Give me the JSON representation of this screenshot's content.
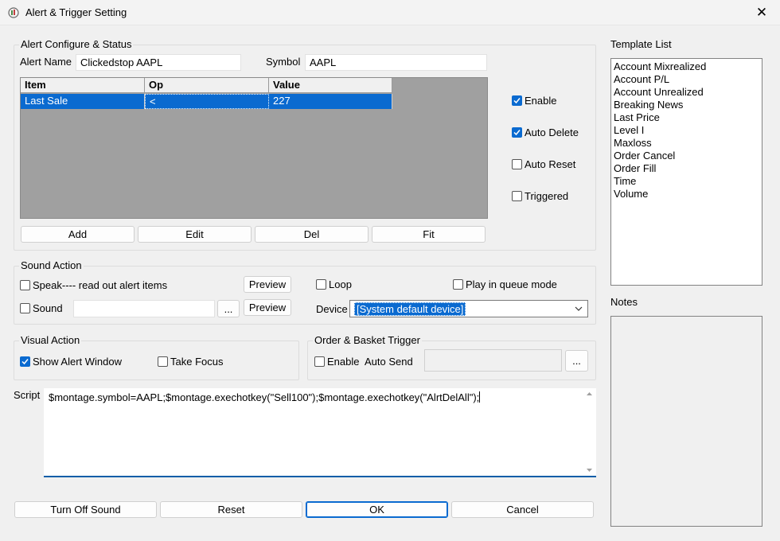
{
  "window": {
    "title": "Alert & Trigger Setting",
    "close_symbol": "✕"
  },
  "alert_configure": {
    "group_title": "Alert Configure & Status",
    "alert_name_label": "Alert Name",
    "alert_name_value": "Clickedstop AAPL",
    "symbol_label": "Symbol",
    "symbol_value": "AAPL",
    "grid": {
      "columns": [
        "Item",
        "Op",
        "Value"
      ],
      "rows": [
        {
          "item": "Last Sale",
          "op": "<",
          "value": "227"
        }
      ]
    },
    "buttons": {
      "add": "Add",
      "edit": "Edit",
      "del": "Del",
      "fit": "Fit"
    },
    "checkboxes": {
      "enable": {
        "label": "Enable",
        "checked": true
      },
      "auto_delete": {
        "label": "Auto Delete",
        "checked": true
      },
      "auto_reset": {
        "label": "Auto Reset",
        "checked": false
      },
      "triggered": {
        "label": "Triggered",
        "checked": false
      }
    }
  },
  "template_list": {
    "title": "Template List",
    "items": [
      "Account Mixrealized",
      "Account P/L",
      "Account Unrealized",
      "Breaking News",
      "Last Price",
      "Level I",
      "Maxloss",
      "Order Cancel",
      "Order Fill",
      "Time",
      "Volume"
    ]
  },
  "notes": {
    "title": "Notes"
  },
  "sound_action": {
    "group_title": "Sound Action",
    "speak_label": "Speak---- read out alert items",
    "speak_checked": false,
    "sound_label": "Sound",
    "sound_checked": false,
    "sound_file_value": "",
    "browse_label": "...",
    "preview_label": "Preview",
    "loop_label": "Loop",
    "loop_checked": false,
    "queue_label": "Play in queue mode",
    "queue_checked": false,
    "device_label": "Device",
    "device_value": "[System default device]"
  },
  "visual_action": {
    "group_title": "Visual Action",
    "show_alert_label": "Show Alert Window",
    "show_alert_checked": true,
    "take_focus_label": "Take Focus",
    "take_focus_checked": false
  },
  "order_basket": {
    "group_title": "Order & Basket Trigger",
    "enable_label": "Enable",
    "enable_checked": false,
    "auto_send_label": "Auto Send",
    "browse_label": "..."
  },
  "script": {
    "label": "Script",
    "value": "$montage.symbol=AAPL;$montage.exechotkey(\"Sell100\");$montage.exechotkey(\"AlrtDelAll\");"
  },
  "footer": {
    "turn_off_sound": "Turn Off Sound",
    "reset": "Reset",
    "ok": "OK",
    "cancel": "Cancel"
  },
  "colors": {
    "accent": "#0a6ad0",
    "grid_bg": "#a0a0a0",
    "window_bg": "#f0f0f0"
  }
}
